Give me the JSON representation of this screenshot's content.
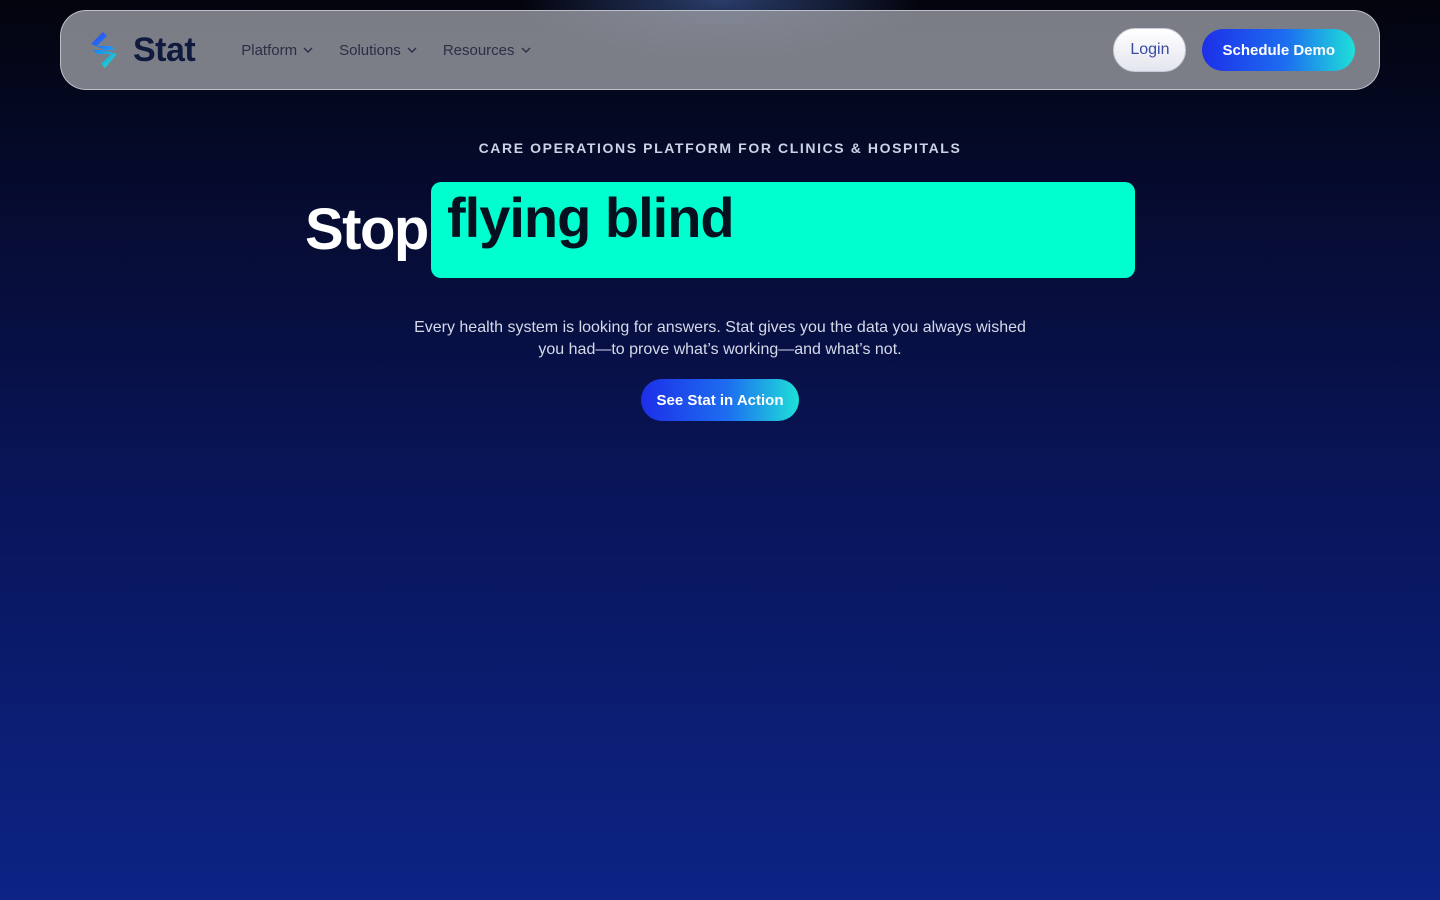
{
  "brand": {
    "name": "Stat",
    "accent": "#00ffcf",
    "primary": "#1d2fe8"
  },
  "nav": {
    "items": [
      {
        "label": "Platform"
      },
      {
        "label": "Solutions"
      },
      {
        "label": "Resources"
      }
    ],
    "login_label": "Login",
    "demo_label": "Schedule Demo"
  },
  "hero": {
    "eyebrow": "CARE OPERATIONS PLATFORM FOR CLINICS & HOSPITALS",
    "headline_prefix": "Stop",
    "headline_highlight": "flying blind",
    "subtext": "Every health system is looking for answers. Stat gives you the data you always wished you had—to prove what’s working—and what’s not.",
    "cta_label": "See Stat in Action"
  },
  "icons": [
    "stat-logo-icon",
    "chevron-down-icon"
  ]
}
